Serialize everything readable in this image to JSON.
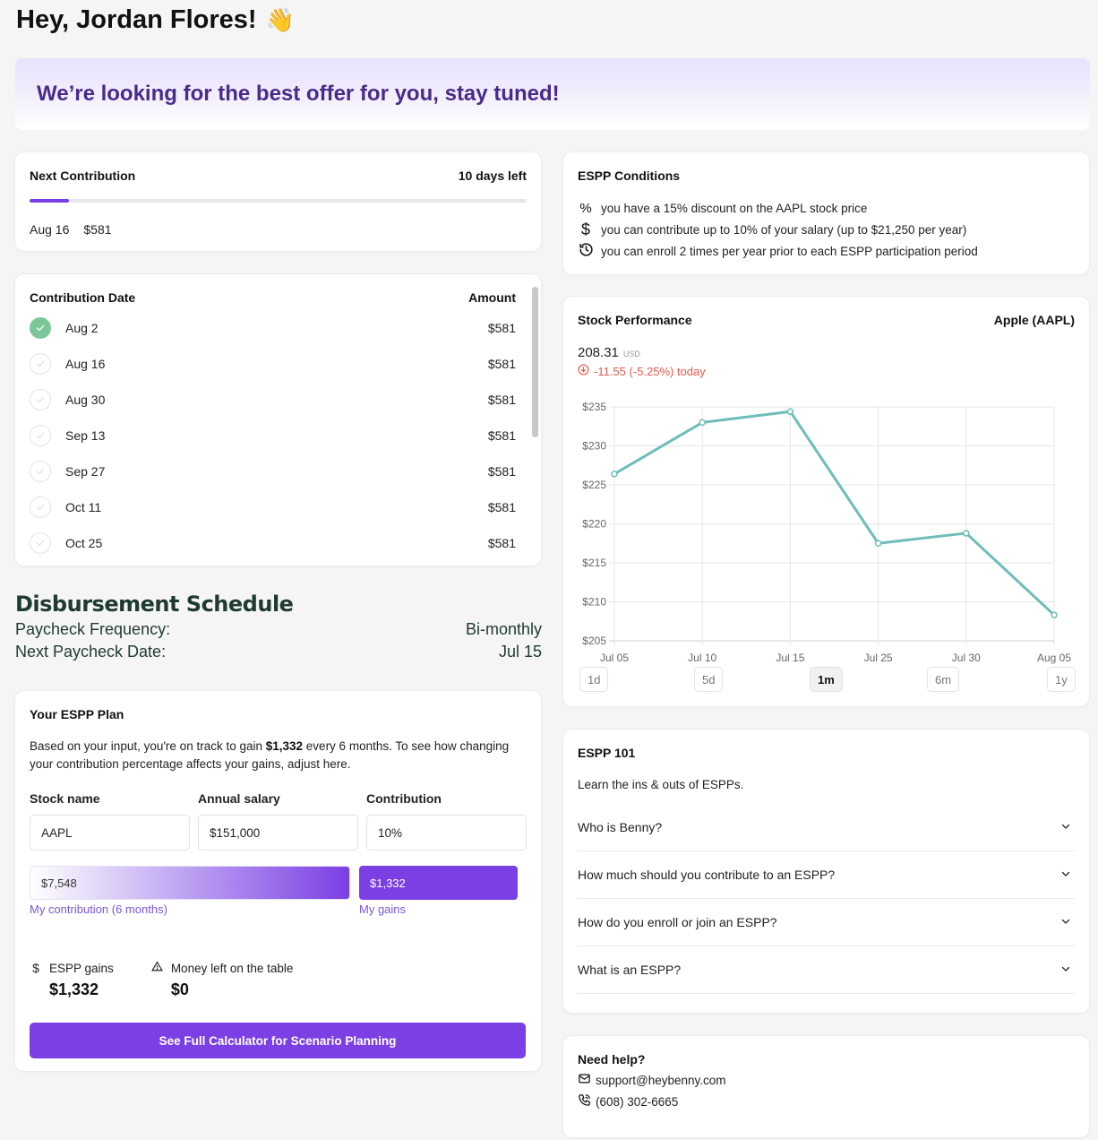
{
  "greeting": {
    "text": "Hey, Jordan Flores!",
    "emoji": "👋"
  },
  "banner": {
    "text": "We’re looking for the best offer for you, stay tuned!"
  },
  "next_contribution": {
    "title": "Next Contribution",
    "days_left": "10 days left",
    "progress_percent": 8,
    "date": "Aug 16",
    "amount": "$581"
  },
  "contributions": {
    "header_date": "Contribution Date",
    "header_amount": "Amount",
    "rows": [
      {
        "date": "Aug 2",
        "amount": "$581",
        "done": true
      },
      {
        "date": "Aug 16",
        "amount": "$581",
        "done": false
      },
      {
        "date": "Aug 30",
        "amount": "$581",
        "done": false
      },
      {
        "date": "Sep 13",
        "amount": "$581",
        "done": false
      },
      {
        "date": "Sep 27",
        "amount": "$581",
        "done": false
      },
      {
        "date": "Oct 11",
        "amount": "$581",
        "done": false
      },
      {
        "date": "Oct 25",
        "amount": "$581",
        "done": false
      }
    ]
  },
  "disbursement": {
    "title": "Disbursement Schedule",
    "frequency_label": "Paycheck Frequency:",
    "frequency_value": "Bi-monthly",
    "next_label": "Next Paycheck Date:",
    "next_value": "Jul 15"
  },
  "plan": {
    "title": "Your ESPP Plan",
    "desc_prefix": "Based on your input, you're on track to gain ",
    "desc_amount": "$1,332",
    "desc_suffix": " every 6 months. To see how changing your contribution percentage affects your gains, adjust here.",
    "fields": [
      {
        "label": "Stock name",
        "value": "AAPL"
      },
      {
        "label": "Annual salary",
        "value": "$151,000"
      },
      {
        "label": "Contribution",
        "value": "10%"
      }
    ],
    "contribution_bar_value": "$7,548",
    "gains_bar_value": "$1,332",
    "contribution_bar_label": "My contribution (6 months)",
    "gains_bar_label": "My gains",
    "stats": [
      {
        "icon": "dollar-icon",
        "label": "ESPP gains",
        "value": "$1,332"
      },
      {
        "icon": "warning-icon",
        "label": "Money left on the table",
        "value": "$0"
      }
    ],
    "cta": "See Full Calculator for Scenario Planning"
  },
  "conditions": {
    "title": "ESPP Conditions",
    "items": [
      {
        "icon": "percent-icon",
        "text": "you have a 15% discount on the AAPL stock price"
      },
      {
        "icon": "dollar-icon",
        "text": "you can contribute up to 10% of your salary (up to $21,250 per year)"
      },
      {
        "icon": "history-icon",
        "text": "you can enroll 2 times per year prior to each ESPP participation period"
      }
    ]
  },
  "stock": {
    "title": "Stock Performance",
    "company": "Apple (AAPL)",
    "price": "208.31",
    "currency": "USD",
    "change": "-11.55 (-5.25%) today",
    "ranges": [
      "1d",
      "5d",
      "1m",
      "6m",
      "1y"
    ],
    "active_range": "1m",
    "line_color": "#6dbdb9"
  },
  "chart_data": {
    "type": "line",
    "title": "",
    "xlabel": "",
    "ylabel": "",
    "x": [
      "Jul 05",
      "Jul 10",
      "Jul 15",
      "Jul 25",
      "Jul 30",
      "Aug 05"
    ],
    "series": [
      {
        "name": "AAPL",
        "values": [
          226.4,
          233.0,
          234.4,
          217.5,
          218.8,
          208.31
        ]
      }
    ],
    "y_ticks": [
      "$205",
      "$210",
      "$215",
      "$220",
      "$225",
      "$230",
      "$235"
    ],
    "ylim": [
      205,
      235
    ],
    "grid": true,
    "legend": "none"
  },
  "faq": {
    "title": "ESPP 101",
    "subtitle": "Learn the ins & outs of ESPPs.",
    "items": [
      "Who is Benny?",
      "How much should you contribute to an ESPP?",
      "How do you enroll or join an ESPP?",
      "What is an ESPP?"
    ]
  },
  "help": {
    "title": "Need help?",
    "email": "support@heybenny.com",
    "phone": "(608) 302-6665"
  }
}
